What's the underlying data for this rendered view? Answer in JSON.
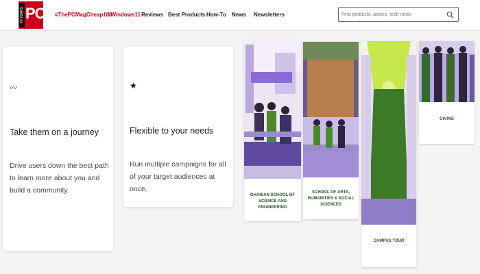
{
  "header": {
    "logo_badge": "40 YEARS",
    "logo_text": "PC",
    "nav": [
      {
        "label": "#ThePCMagCheap100"
      },
      {
        "label": "#Windows11"
      },
      {
        "label": "Reviews"
      },
      {
        "label": "Best Products"
      },
      {
        "label": "How-To"
      },
      {
        "label": "News"
      },
      {
        "label": "Newsletters"
      }
    ],
    "search_placeholder": "Find products, advice, tech news"
  },
  "features": [
    {
      "icon": "trend-icon",
      "glyph": "〰",
      "title": "Take them on a journey",
      "text": "Drive users down the best path to learn more about you and build a community."
    },
    {
      "icon": "star-icon",
      "glyph": "★",
      "title": "Flexible to your needs",
      "text": "Run multiple campaigns for all of your target audiences at once."
    }
  ],
  "tiles": [
    {
      "caption": "Ohanian School of Science and Engineering"
    },
    {
      "caption": "School of Arts, Humanities & Social Sciences"
    },
    {
      "caption": "Campus Tour"
    },
    {
      "caption": "Giving"
    }
  ],
  "colors": {
    "brand": "#d0021b",
    "caption_green": "#225522",
    "accent_purple": "#8a6bd6",
    "accent_green": "#4a8a2a"
  }
}
